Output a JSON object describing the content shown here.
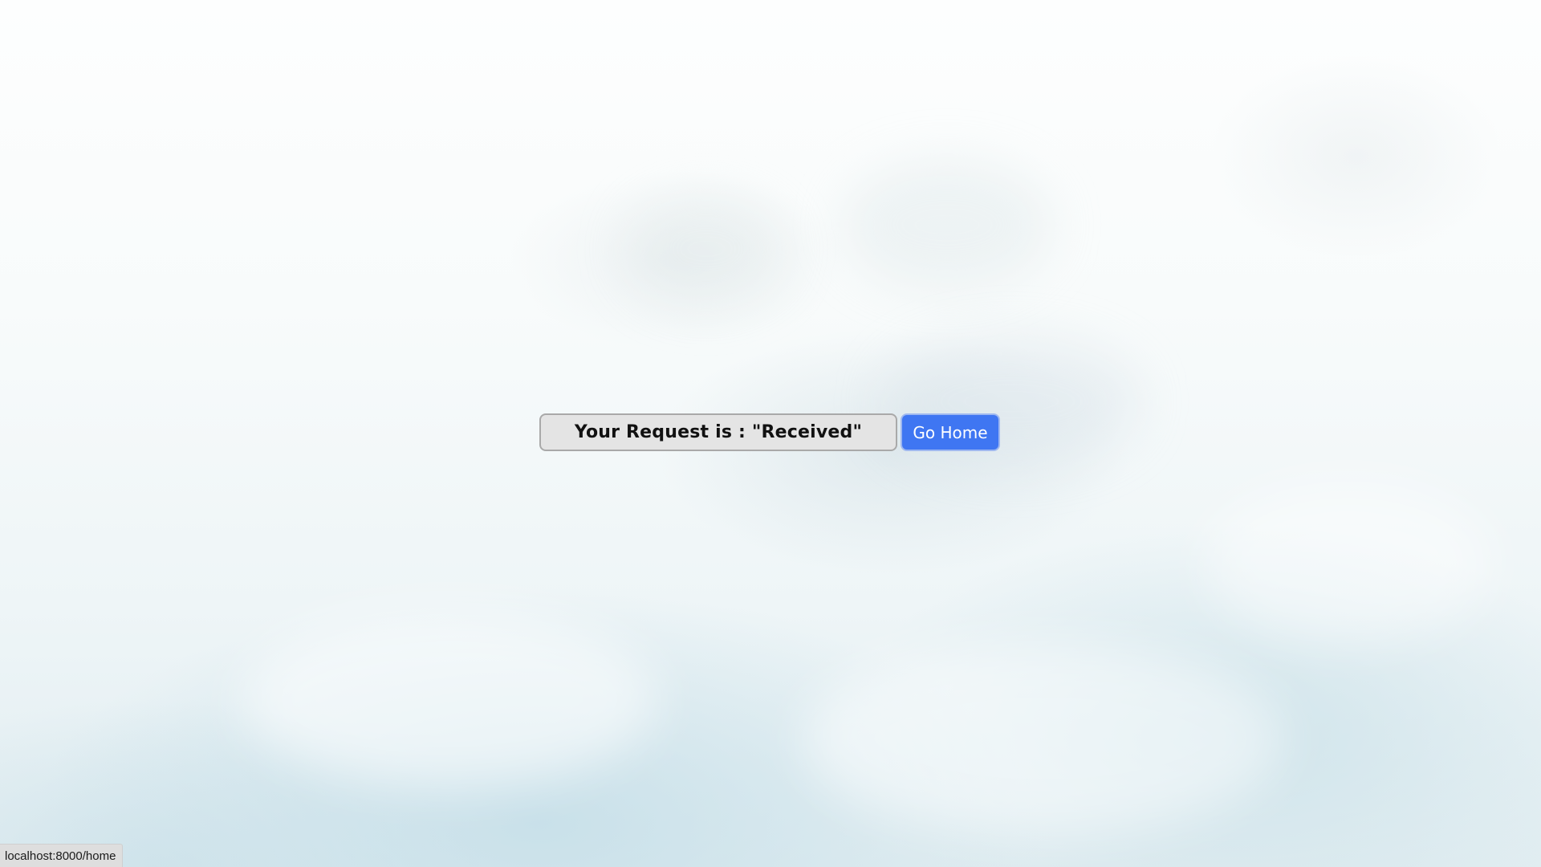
{
  "main": {
    "status_text": "Your Request is : \"Received\"",
    "go_home_label": "Go Home"
  },
  "status_bar": {
    "link_url": "localhost:8000/home"
  },
  "colors": {
    "button_bg": "#3f76f2",
    "status_box_bg": "#e4e4e4",
    "sky_tint": "#e1edf1"
  }
}
